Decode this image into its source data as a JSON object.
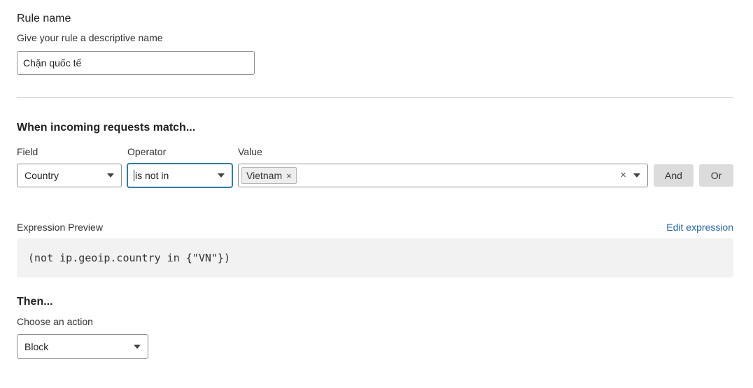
{
  "rule_name": {
    "heading": "Rule name",
    "description": "Give your rule a descriptive name",
    "value": "Chặn quốc tế"
  },
  "match": {
    "heading": "When incoming requests match...",
    "field_label": "Field",
    "operator_label": "Operator",
    "value_label": "Value",
    "field_value": "Country",
    "operator_value": "is not in",
    "value_chips": [
      "Vietnam"
    ],
    "chip_remove": "×",
    "clear_all": "×",
    "and_button": "And",
    "or_button": "Or"
  },
  "expression": {
    "label": "Expression Preview",
    "edit_link": "Edit expression",
    "code": "(not ip.geoip.country in {\"VN\"})"
  },
  "then": {
    "heading": "Then...",
    "description": "Choose an action",
    "action_value": "Block"
  },
  "colors": {
    "link": "#1e66b3",
    "focus_border": "#2c7cb0",
    "code_background": "#f2f2f2",
    "button_background": "#dcdcdc"
  }
}
